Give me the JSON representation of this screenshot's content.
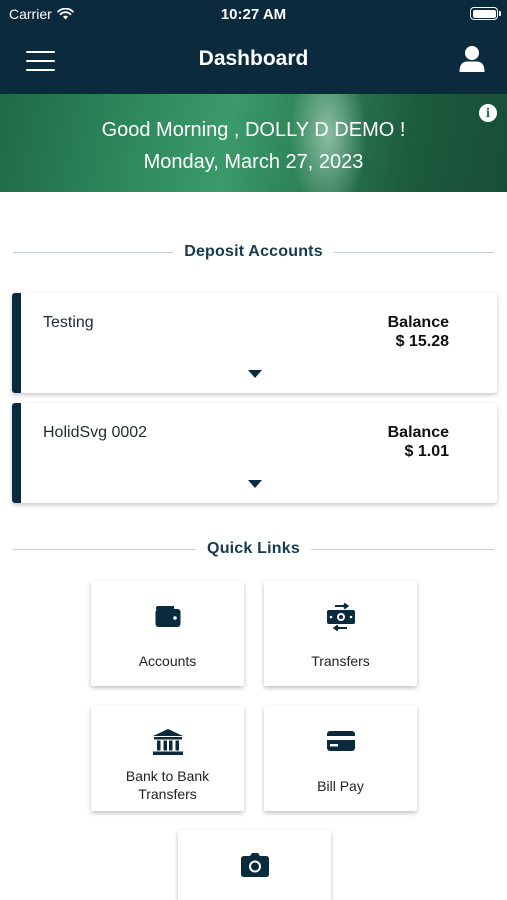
{
  "status_bar": {
    "carrier": "Carrier",
    "time": "10:27 AM"
  },
  "nav": {
    "title": "Dashboard",
    "menu_icon": "hamburger-menu-icon",
    "profile_icon": "user-profile-icon"
  },
  "banner": {
    "greeting": "Good Morning , DOLLY D DEMO !",
    "date": "Monday, March 27, 2023",
    "info_icon": "info-icon"
  },
  "deposit_accounts": {
    "heading": "Deposit Accounts",
    "accounts": [
      {
        "name": "Testing",
        "balance_label": "Balance",
        "balance": "$ 15.28"
      },
      {
        "name": "HolidSvg 0002",
        "balance_label": "Balance",
        "balance": "$ 1.01"
      }
    ]
  },
  "quick_links": {
    "heading": "Quick Links",
    "items": [
      {
        "label": "Accounts",
        "icon": "wallet-icon"
      },
      {
        "label": "Transfers",
        "icon": "money-transfer-icon"
      },
      {
        "label": "Bank to Bank Transfers",
        "icon": "bank-icon"
      },
      {
        "label": "Bill Pay",
        "icon": "credit-card-icon"
      },
      {
        "label": "",
        "icon": "camera-icon"
      }
    ]
  },
  "colors": {
    "nav_bg": "#0c2a3d",
    "banner_green": "#2f8a5d",
    "accent": "#163a50"
  }
}
